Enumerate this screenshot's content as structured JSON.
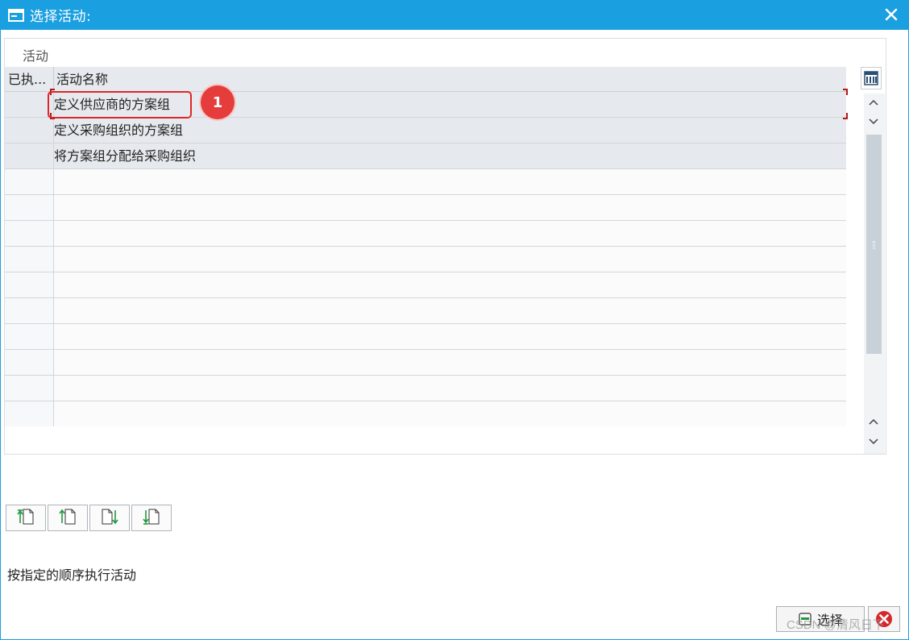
{
  "window": {
    "title": "选择活动:"
  },
  "panel": {
    "title": "活动"
  },
  "table": {
    "headers": [
      "已执...",
      "活动名称"
    ],
    "rows": [
      {
        "name": "定义供应商的方案组"
      },
      {
        "name": "定义采购组织的方案组"
      },
      {
        "name": "将方案组分配给采购组织"
      }
    ]
  },
  "annotation": {
    "number": "1"
  },
  "status": {
    "text": "按指定的顺序执行活动"
  },
  "footer": {
    "select_label": "选择",
    "watermark": "CSDN @清风日下"
  },
  "colors": {
    "titlebar": "#1a9fe0",
    "annotation_red": "#e53d3b"
  },
  "icons": [
    "window-icon",
    "close-icon",
    "column-config-icon",
    "scroll-up-icon",
    "scroll-down-icon",
    "move-top-icon",
    "move-up-icon",
    "move-down-icon",
    "move-bottom-icon",
    "select-icon",
    "cancel-icon"
  ]
}
